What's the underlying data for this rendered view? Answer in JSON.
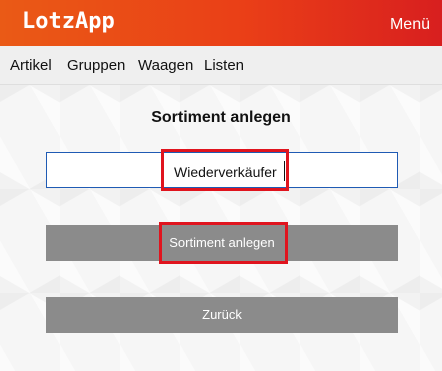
{
  "app": {
    "title": "LotzApp",
    "menu_label": "Menü",
    "brand_color": "#ea4a16",
    "accent_highlight": "#e0141e"
  },
  "nav": {
    "items": [
      "Artikel",
      "Gruppen",
      "Waagen",
      "Listen"
    ]
  },
  "form": {
    "heading": "Sortiment anlegen",
    "input_value": "Wiederverkäufer",
    "submit_label": "Sortiment anlegen",
    "back_label": "Zurück"
  }
}
